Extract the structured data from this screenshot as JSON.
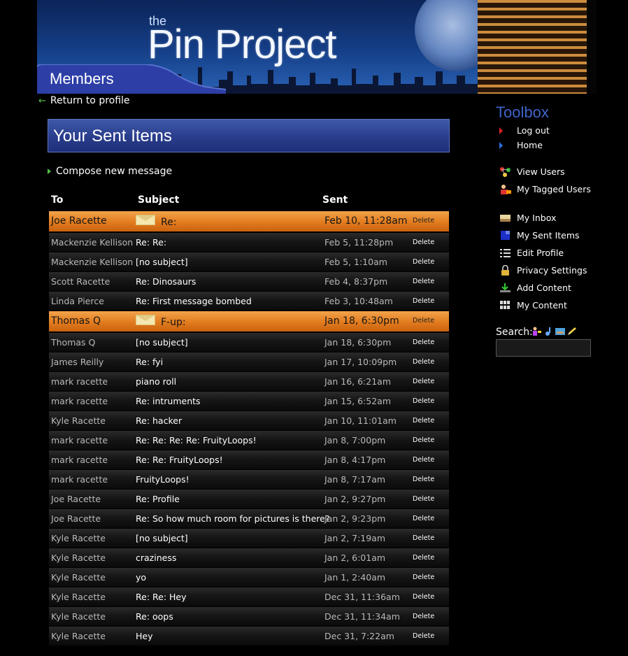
{
  "banner": {
    "logo_prefix": "the",
    "logo": "Pin Project",
    "section": "Members"
  },
  "nav": {
    "return_label": "Return to profile"
  },
  "page": {
    "title": "Your Sent Items",
    "compose_label": "Compose new message"
  },
  "table": {
    "headers": {
      "to": "To",
      "subject": "Subject",
      "sent": "Sent"
    },
    "delete_label": "Delete",
    "rows": [
      {
        "to": "Joe Racette",
        "subject": "Re:",
        "sent": "Feb 10, 11:28am",
        "unread": true
      },
      {
        "to": "Mackenzie Kellison",
        "subject": "Re: Re:",
        "sent": "Feb 5, 11:28pm"
      },
      {
        "to": "Mackenzie Kellison",
        "subject": "[no subject]",
        "sent": "Feb 5, 1:10am"
      },
      {
        "to": "Scott Racette",
        "subject": "Re: Dinosaurs",
        "sent": "Feb 4, 8:37pm"
      },
      {
        "to": "Linda Pierce",
        "subject": "Re: First message bombed",
        "sent": "Feb 3, 10:48am"
      },
      {
        "to": "Thomas Q",
        "subject": "F-up:",
        "sent": "Jan 18, 6:30pm",
        "unread": true
      },
      {
        "to": "Thomas Q",
        "subject": "[no subject]",
        "sent": "Jan 18, 6:30pm"
      },
      {
        "to": "James Reilly",
        "subject": "Re: fyi",
        "sent": "Jan 17, 10:09pm"
      },
      {
        "to": "mark racette",
        "subject": "piano roll",
        "sent": "Jan 16, 6:21am"
      },
      {
        "to": "mark racette",
        "subject": "Re: intruments",
        "sent": "Jan 15, 6:52am"
      },
      {
        "to": "Kyle Racette",
        "subject": "Re: hacker",
        "sent": "Jan 10, 11:01am"
      },
      {
        "to": "mark racette",
        "subject": "Re: Re: Re: Re: FruityLoops!",
        "sent": "Jan 8, 7:00pm"
      },
      {
        "to": "mark racette",
        "subject": "Re: Re: FruityLoops!",
        "sent": "Jan 8, 4:17pm"
      },
      {
        "to": "mark racette",
        "subject": "FruityLoops!",
        "sent": "Jan 8, 7:17am"
      },
      {
        "to": "Joe Racette",
        "subject": "Re: Profile",
        "sent": "Jan 2, 9:27pm"
      },
      {
        "to": "Joe Racette",
        "subject": "Re: So how much room for pictures is there?",
        "sent": "Jan 2, 9:23pm"
      },
      {
        "to": "Kyle Racette",
        "subject": "[no subject]",
        "sent": "Jan 2, 7:19am"
      },
      {
        "to": "Kyle Racette",
        "subject": "craziness",
        "sent": "Jan 2, 6:01am"
      },
      {
        "to": "Kyle Racette",
        "subject": "yo",
        "sent": "Jan 1, 2:40am"
      },
      {
        "to": "Kyle Racette",
        "subject": "Re: Re: Hey",
        "sent": "Dec 31, 11:36am"
      },
      {
        "to": "Kyle Racette",
        "subject": "Re: oops",
        "sent": "Dec 31, 11:34am"
      },
      {
        "to": "Kyle Racette",
        "subject": "Hey",
        "sent": "Dec 31, 7:22am"
      }
    ]
  },
  "toolbox": {
    "title": "Toolbox",
    "logout": "Log out",
    "home": "Home",
    "view_users": "View Users",
    "tagged_users": "My Tagged Users",
    "inbox": "My Inbox",
    "sent_items": "My Sent Items",
    "edit_profile": "Edit Profile",
    "privacy": "Privacy Settings",
    "add_content": "Add Content",
    "my_content": "My Content"
  },
  "search": {
    "label": "Search:",
    "value": ""
  },
  "colors": {
    "accent_blue": "#3f64c8",
    "unread_orange": "#e27b1e",
    "link_green": "#53c04a"
  }
}
